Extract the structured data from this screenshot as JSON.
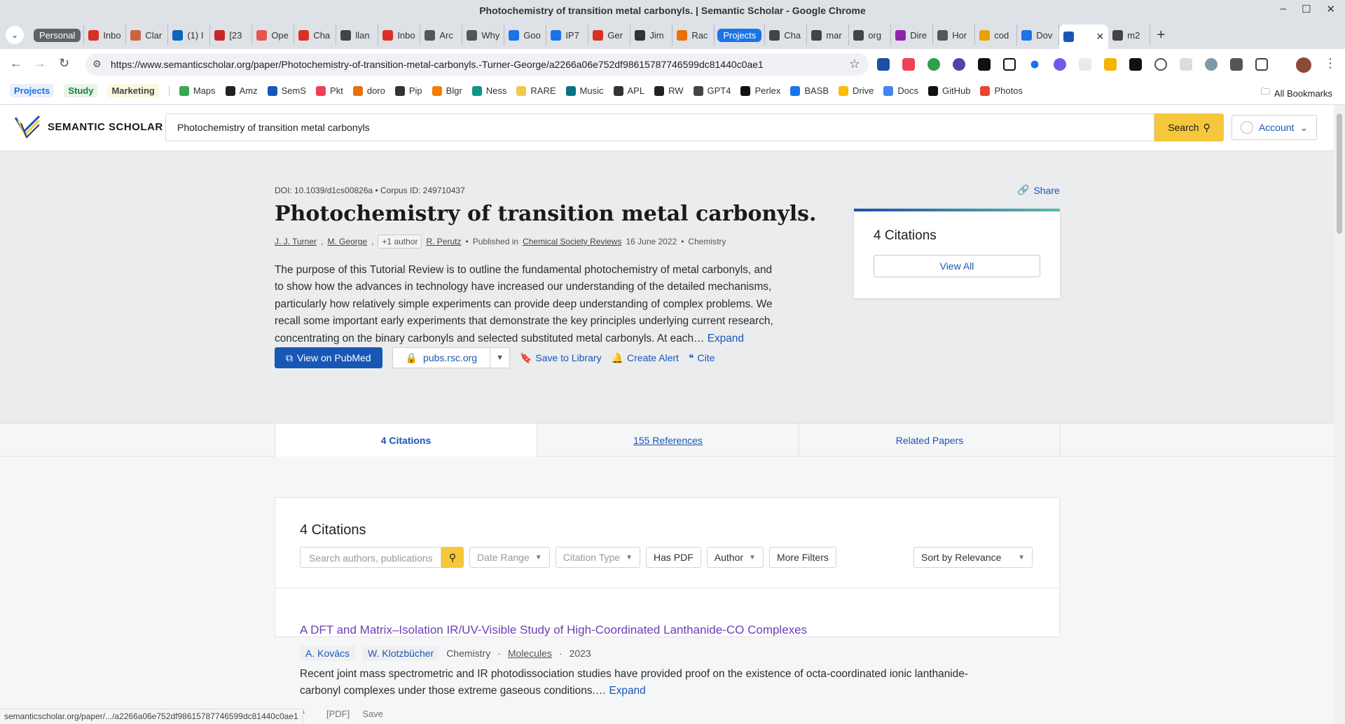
{
  "window": {
    "title": "Photochemistry of transition metal carbonyls. | Semantic Scholar - Google Chrome"
  },
  "tabs": [
    {
      "label": "Personal",
      "type": "group",
      "color": "#5f6368"
    },
    {
      "label": "Inbo",
      "icon": "gmail-icon",
      "color": "#d93025"
    },
    {
      "label": "Clar",
      "icon": "claude-icon",
      "color": "#c96442"
    },
    {
      "label": "(1) I",
      "icon": "linkedin-icon",
      "color": "#0a66c2"
    },
    {
      "label": "[23",
      "icon": "x-icon",
      "color": "#c62828"
    },
    {
      "label": "Ope",
      "icon": "openai-icon",
      "color": "#e5554f"
    },
    {
      "label": "Cha",
      "icon": "gmail-icon",
      "color": "#d93025"
    },
    {
      "label": "llan",
      "icon": "chatgpt-icon",
      "color": "#444"
    },
    {
      "label": "Inbo",
      "icon": "gmail-icon",
      "color": "#d93025"
    },
    {
      "label": "Arc",
      "icon": "arxiv-icon",
      "color": "#555"
    },
    {
      "label": "Why",
      "icon": "perplexity-icon",
      "color": "#555"
    },
    {
      "label": "Goo",
      "icon": "calendar-icon",
      "color": "#1a73e8"
    },
    {
      "label": "IP7",
      "icon": "globe-icon",
      "color": "#1a73e8"
    },
    {
      "label": "Ger",
      "icon": "gemini-icon",
      "color": "#d93025"
    },
    {
      "label": "Jim",
      "icon": "wikipedia-icon",
      "color": "#333"
    },
    {
      "label": "Rac",
      "icon": "bars-icon",
      "color": "#e8710a"
    },
    {
      "label": "Projects",
      "type": "group",
      "color": "#1a73e8"
    },
    {
      "label": "Cha",
      "icon": "chatgpt-icon",
      "color": "#444"
    },
    {
      "label": "mar",
      "icon": "globe-icon",
      "color": "#444"
    },
    {
      "label": "org",
      "icon": "globe-icon",
      "color": "#444"
    },
    {
      "label": "Dire",
      "icon": "dot-icon",
      "color": "#8e24aa"
    },
    {
      "label": "Hor",
      "icon": "perplexity-icon",
      "color": "#555"
    },
    {
      "label": "cod",
      "icon": "note-icon",
      "color": "#e8a300"
    },
    {
      "label": "Dov",
      "icon": "download-icon",
      "color": "#1a73e8"
    },
    {
      "label": "",
      "icon": "semantic-scholar-icon",
      "color": "#1857b6",
      "active": true
    },
    {
      "label": "m2",
      "icon": "globe-icon",
      "color": "#444"
    }
  ],
  "toolbar": {
    "url": "https://www.semanticscholar.org/paper/Photochemistry-of-transition-metal-carbonyls.-Turner-George/a2266a06e752df98615787746599dc81440c0ae1"
  },
  "bookmarks": {
    "groups": [
      {
        "label": "Projects",
        "color": "#1a73e8",
        "bg": "#e8f0fe"
      },
      {
        "label": "Study",
        "color": "#188038",
        "bg": "#e6f4ea"
      },
      {
        "label": "Marketing",
        "color": "#444",
        "bg": "#fef7e0"
      }
    ],
    "items": [
      {
        "label": "Maps",
        "color": "#34a853"
      },
      {
        "label": "Amz",
        "color": "#222"
      },
      {
        "label": "SemS",
        "color": "#1857b6"
      },
      {
        "label": "Pkt",
        "color": "#ef4056"
      },
      {
        "label": "doro",
        "color": "#e8710a"
      },
      {
        "label": "Pip",
        "color": "#333"
      },
      {
        "label": "Blgr",
        "color": "#f57d00"
      },
      {
        "label": "Ness",
        "color": "#0d9488"
      },
      {
        "label": "RARE",
        "color": "#f2c94c"
      },
      {
        "label": "Music",
        "color": "#0b7285"
      },
      {
        "label": "APL",
        "color": "#333"
      },
      {
        "label": "RW",
        "color": "#222"
      },
      {
        "label": "GPT4",
        "color": "#444"
      },
      {
        "label": "Perlex",
        "color": "#111"
      },
      {
        "label": "BASB",
        "color": "#1a73e8"
      },
      {
        "label": "Drive",
        "color": "#fbbc04"
      },
      {
        "label": "Docs",
        "color": "#4285f4"
      },
      {
        "label": "GitHub",
        "color": "#111"
      },
      {
        "label": "Photos",
        "color": "#ea4335"
      }
    ],
    "all_label": "All Bookmarks"
  },
  "header": {
    "logo_text": "SEMANTIC SCHOLAR",
    "search_value": "Photochemistry of transition metal carbonyls",
    "search_label": "Search",
    "account_label": "Account"
  },
  "paper": {
    "doi": "DOI: 10.1039/d1cs00826a",
    "corpus": "Corpus ID: 249710437",
    "title": "Photochemistry of transition metal carbonyls.",
    "authors": [
      "J. J. Turner",
      "M. George",
      "R. Perutz"
    ],
    "more_authors": "+1 author",
    "published_in_label": "Published in",
    "journal": "Chemical Society Reviews",
    "date": "16 June 2022",
    "field": "Chemistry",
    "abstract": "The purpose of this Tutorial Review is to outline the fundamental photochemistry of metal carbonyls, and to show how the advances in technology have increased our understanding of the detailed mechanisms, particularly how relatively simple experiments can provide deep understanding of complex problems. We recall some important early experiments that demonstrate the key principles underlying current research, concentrating on the binary carbonyls and selected substituted metal carbonyls. At each…",
    "expand_label": "Expand"
  },
  "actions": {
    "pubmed": "View on PubMed",
    "publisher": "pubs.rsc.org",
    "save": "Save to Library",
    "alert": "Create Alert",
    "cite": "Cite"
  },
  "sidebar": {
    "share": "Share",
    "citations_count": "4 Citations",
    "view_all": "View All"
  },
  "paper_tabs": [
    {
      "label": "4 Citations",
      "active": true
    },
    {
      "label": "155 References"
    },
    {
      "label": "Related Papers"
    }
  ],
  "citations": {
    "heading": "4 Citations",
    "search_placeholder": "Search authors, publications",
    "filters": {
      "date_range": "Date Range",
      "citation_type": "Citation Type",
      "has_pdf": "Has PDF",
      "author": "Author",
      "more": "More Filters"
    },
    "sort": "Sort by Relevance",
    "results": [
      {
        "title": "A DFT and Matrix–Isolation IR/UV-Visible Study of High-Coordinated Lanthanide-CO Complexes",
        "authors": [
          "A. Kovács",
          "W. Klotzbücher"
        ],
        "field": "Chemistry",
        "venue": "Molecules",
        "year": "2023",
        "abstract": "Recent joint mass spectrometric and IR photodissociation studies have provided proof on the existence of octa-coordinated ionic lanthanide-carbonyl complexes under those extreme gaseous conditions.…",
        "expand_label": "Expand",
        "pdf_label": "[PDF]",
        "save_label": "Save"
      }
    ]
  },
  "statusbar": {
    "url": "semanticscholar.org/paper/.../a2266a06e752df98615787746599dc81440c0ae1"
  }
}
